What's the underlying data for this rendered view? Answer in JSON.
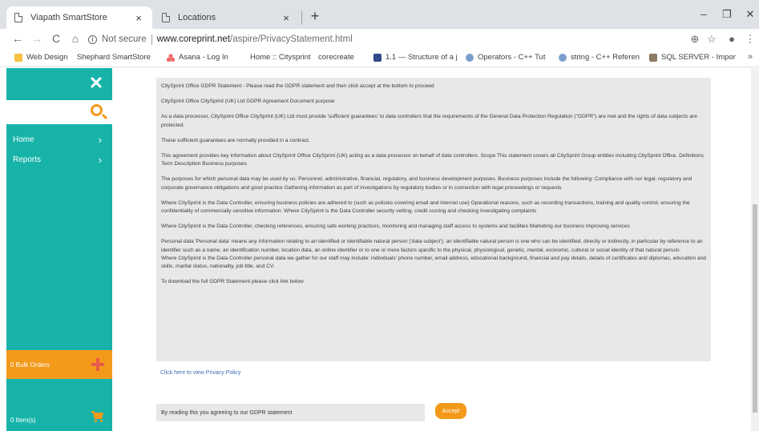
{
  "browser": {
    "tabs": [
      {
        "title": "Viapath SmartStore",
        "active": true
      },
      {
        "title": "Locations",
        "active": false
      }
    ],
    "close_glyph": "×",
    "new_tab_glyph": "+",
    "window_controls": {
      "minimize": "–",
      "maximize": "❐",
      "close": "✕"
    },
    "nav": {
      "back": "←",
      "forward": "→",
      "reload": "C",
      "home": "⌂"
    },
    "address": {
      "security_label": "Not secure",
      "host": "www.coreprint.net",
      "path": "/aspire/PrivacyStatement.html"
    },
    "toolbar_right": {
      "zoom": "⊕",
      "star": "☆",
      "profile": "●",
      "menu": "⋮"
    },
    "bookmarks": [
      {
        "label": "Web Design",
        "icon": "folder-icon"
      },
      {
        "label": "Shephard SmartStore",
        "icon": "page-icon"
      },
      {
        "label": "Asana - Log In",
        "icon": "asana-icon"
      },
      {
        "label": "Home :: Citysprint",
        "icon": "none"
      },
      {
        "label": "corecreate",
        "icon": "page-icon"
      },
      {
        "label": "1.1 — Structure of a j",
        "icon": "site-icon"
      },
      {
        "label": "Operators - C++ Tut",
        "icon": "cpp-icon"
      },
      {
        "label": "string - C++ Referen",
        "icon": "cpp-icon"
      },
      {
        "label": "SQL SERVER - Impor",
        "icon": "sql-icon"
      }
    ],
    "bookmarks_more": "»"
  },
  "sidebar": {
    "close_glyph": "✕",
    "items": [
      {
        "label": "Home",
        "chevron": "›"
      },
      {
        "label": "Reports",
        "chevron": "›"
      }
    ],
    "bulk_orders_label": "0 Bulk Orders",
    "items_label": "0 Item(s)"
  },
  "gdpr": {
    "paragraphs": [
      "CitySprint Office GDPR Statement - Please read the GDPR statement and then click accept at the bottom to proceed",
      "CitySprint Office CitySprint (UK) Ltd GDPR Agreement Document purpose",
      "As a data processor, CitySprint Office CitySprint (UK) Ltd must provide 'sufficient guarantees' to data controllers that the requirements of the General Data Protection Regulation (\"GDPR\") are met and the rights of data subjects are protected.",
      "These sufficient guarantees are normally provided in a contract.",
      "This agreement provides key information about CitySprint Office CitySprint (UK) acting as a data processor on behalf of data controllers. Scope This statement covers all CitySprint Group entities including CitySprint Office. Definitions Term Description Business purposes",
      "The purposes for which personal data may be used by us: Personnel, administrative, financial, regulatory, and business development purposes. Business purposes include the following: Compliance with our legal, regulatory and corporate governance obligations and good practice Gathering information as part of investigations by regulatory bodies or in connection with legal proceedings or requests",
      "Where CitySprint is the Data Controller, ensuring business policies are adhered to (such as policies covering email and internet use) Operational reasons, such as recording transactions, training and quality control, ensuring the confidentiality of commercially sensitive information. Where CitySprint is the Data Controller security vetting, credit scoring and checking Investigating complaints",
      "Where CitySprint is the Data Controller, checking references, ensuring safe working practices, monitoring and managing staff access to systems and facilities Marketing our business Improving services",
      "Personal data 'Personal data' means any information relating to an identified or identifiable natural person ('data subject'); an identifiable natural person is one who can be identified, directly or indirectly, in particular by reference to an identifier such as a name, an identification number, location data, an online identifier or to one or more factors specific to the physical, physiological, genetic, mental, economic, cultural or social identity of that natural person.",
      "Where CitySprint is the Data Controller personal data we gather for our staff may include: individuals' phone number, email address, educational background, financial and pay details, details of certificates and diplomas, education and skills, marital status, nationality, job title, and CV.",
      "To download the full GDPR Statement please click link below"
    ],
    "privacy_link": "Click here to view Privacy Policy",
    "agree_text": "By reading this you agreeing to our GDPR statement",
    "accept_label": "Accept"
  },
  "colors": {
    "sidebar_teal": "#17b3a8",
    "accent_orange": "#f39a1b",
    "content_gray": "#e8e8e8",
    "link_blue": "#3d6fb4"
  }
}
